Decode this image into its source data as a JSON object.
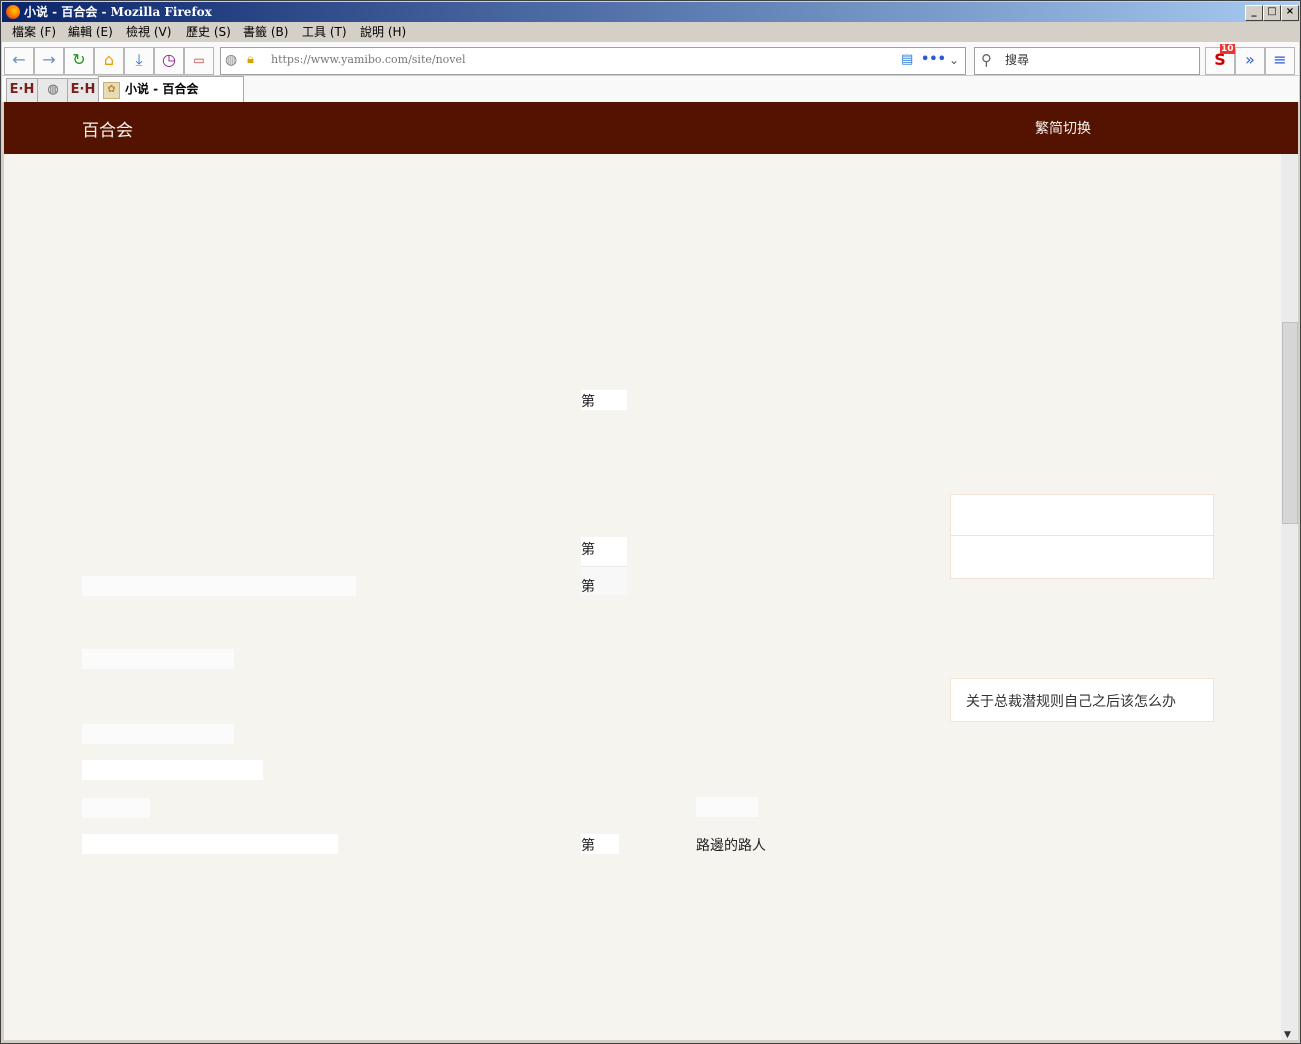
{
  "window": {
    "title": "小说 - 百合会 - Mozilla Firefox"
  },
  "menubar": {
    "items": [
      "檔案 (F)",
      "編輯 (E)",
      "檢視 (V)",
      "歷史 (S)",
      "書籤 (B)",
      "工具 (T)",
      "說明 (H)"
    ]
  },
  "navbar": {
    "url": "https://www.yamibo.com/site/novel",
    "search_placeholder": "搜尋",
    "badge_count": "10"
  },
  "tabs": {
    "pinned": [
      "E·H",
      "",
      "E·H"
    ],
    "active_label": "小说 - 百合会"
  },
  "page": {
    "brand": "百合会",
    "lang_switch": "繁简切换",
    "chapter_marks": [
      "第",
      "第",
      "第",
      "第"
    ],
    "card_title": "关于总裁潜规则自己之后该怎么办",
    "author": "路邊的路人"
  }
}
